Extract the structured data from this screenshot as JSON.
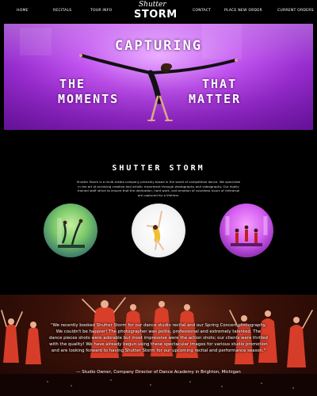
{
  "nav": {
    "items": [
      "HOME",
      "RECITALS",
      "TOUR INFO",
      "CONTACT",
      "PLACE NEW ORDER",
      "CURRENT ORDERS"
    ],
    "logo_script": "Shutter",
    "logo_brand": "STORM"
  },
  "hero": {
    "line1": "CAPTURING",
    "word_the": "THE",
    "word_that": "THAT",
    "word_moments": "MOMENTS",
    "word_matter": "MATTER"
  },
  "section": {
    "title": "SHUTTER STORM",
    "description": "Shutter Storm is a multi-media company primarily based in the world of competitive dance. We specialize in the art of archiving creative and artistic movement through photography and videography. Our highly trained staff strive to ensure that the dedication, hard work, and emotion of countless hours of rehearsal are captured for a lifetime."
  },
  "testimonial": {
    "quote": "\"We recently booked Shutter Storm for our dance studio recital and our Spring Concert photography. We couldn't be happier! The photographer was polite, professional and extremely talented. The dance pieces shots were adorable but most impressive were the action shots; our clients were thrilled with the quality! We have already begun using these spectacular images for various studio promotion and are looking forward to having Shutter Storm for our upcoming recital and performance season.\"",
    "attribution": "— Studio Owner, Company Director of Dance Academy in Brighton, Michigan"
  },
  "colors": {
    "hero_purple": "#b040e0",
    "background": "#000000",
    "bottom_red": "#e0402a"
  }
}
